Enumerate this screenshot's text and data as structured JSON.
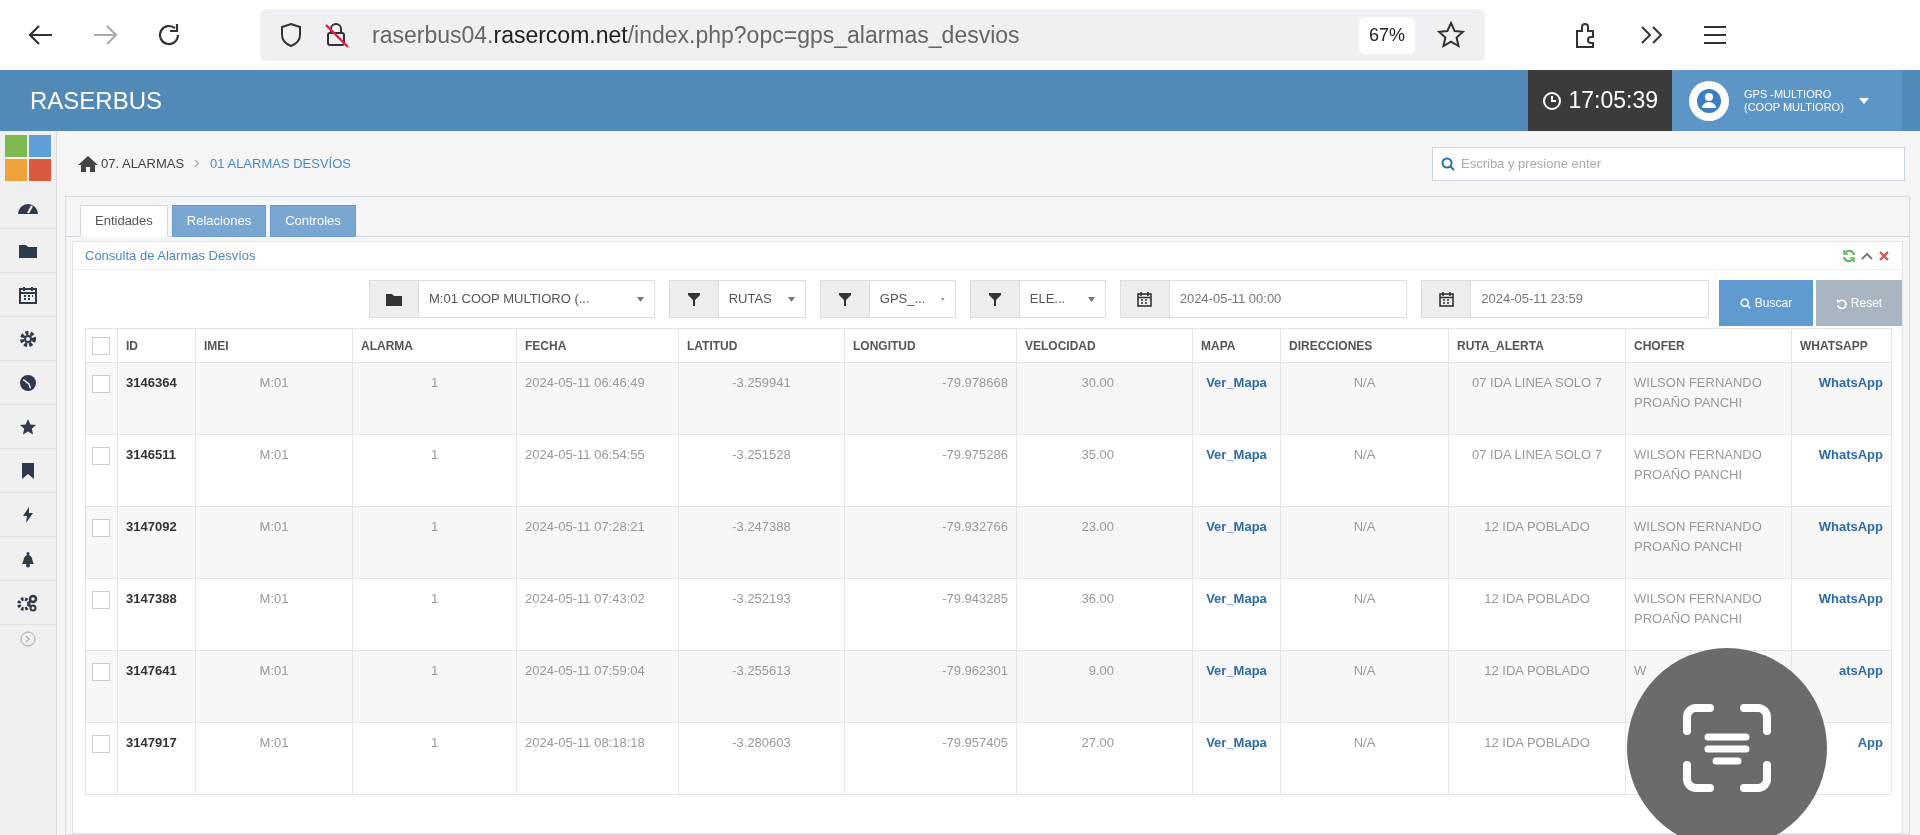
{
  "browser": {
    "url": "raserbus04.**rasercom.net**/index.php?opc=gps_alarmas_desvios",
    "zoom": "67%"
  },
  "header": {
    "brand": "RASERBUS",
    "clock": "17:05:39",
    "user": [
      "GPS -MULTIORO",
      "(COOP MULTIORO)"
    ]
  },
  "breadcrumb": [
    "07. ALARMAS",
    "01 ALARMAS DESVÍOS"
  ],
  "search": {
    "placeholder": "Escriba y presione enter"
  },
  "tabs": [
    {
      "label": "Entidades",
      "selected": true
    },
    {
      "label": "Relaciones",
      "selected": false
    },
    {
      "label": "Controles",
      "selected": false
    }
  ],
  "panel": {
    "title": "Consulta de Alarmas Desvíos"
  },
  "filters": [
    {
      "kind": "entity",
      "value": "M:01 COOP MULTIORO (..."
    },
    {
      "kind": "filter",
      "value": "RUTAS"
    },
    {
      "kind": "filter",
      "value": "GPS_..."
    },
    {
      "kind": "filter",
      "value": "ELE..."
    },
    {
      "kind": "date",
      "value": "2024-05-11 00:00"
    },
    {
      "kind": "date",
      "value": "2024-05-11 23:59"
    }
  ],
  "buttons": [
    "Buscar",
    "Reset"
  ],
  "table": {
    "all_checked": false,
    "columns": [
      "ID",
      "IMEI",
      "ALARMA",
      "FECHA",
      "LATITUD",
      "LONGITUD",
      "VELOCIDAD",
      "MAPA",
      "DIRECCIONES",
      "RUTA_ALERTA",
      "CHOFER",
      "WHATSAPP"
    ],
    "rows": [
      {
        "checked": false,
        "id": "3146364",
        "imei": "M:01",
        "alarma": "1",
        "fecha": "2024-05-11 06:46:49",
        "latitud": "-3.259941",
        "longitud": "-79.978668",
        "velocidad": "30.00",
        "mapa": "Ver_Mapa",
        "direcciones": "N/A",
        "ruta_alerta": "07 IDA LINEA SOLO 7",
        "chofer": "WILSON FERNANDO PROAÑO PANCHI",
        "whatsapp": "WhatsApp"
      },
      {
        "checked": false,
        "id": "3146511",
        "imei": "M:01",
        "alarma": "1",
        "fecha": "2024-05-11 06:54:55",
        "latitud": "-3.251528",
        "longitud": "-79.975286",
        "velocidad": "35.00",
        "mapa": "Ver_Mapa",
        "direcciones": "N/A",
        "ruta_alerta": "07 IDA LINEA SOLO 7",
        "chofer": "WILSON FERNANDO PROAÑO PANCHI",
        "whatsapp": "WhatsApp"
      },
      {
        "checked": false,
        "id": "3147092",
        "imei": "M:01",
        "alarma": "1",
        "fecha": "2024-05-11 07:28:21",
        "latitud": "-3.247388",
        "longitud": "-79.932766",
        "velocidad": "23.00",
        "mapa": "Ver_Mapa",
        "direcciones": "N/A",
        "ruta_alerta": "12 IDA POBLADO",
        "chofer": "WILSON FERNANDO PROAÑO PANCHI",
        "whatsapp": "WhatsApp"
      },
      {
        "checked": false,
        "id": "3147388",
        "imei": "M:01",
        "alarma": "1",
        "fecha": "2024-05-11 07:43:02",
        "latitud": "-3.252193",
        "longitud": "-79.943285",
        "velocidad": "36.00",
        "mapa": "Ver_Mapa",
        "direcciones": "N/A",
        "ruta_alerta": "12 IDA POBLADO",
        "chofer": "WILSON FERNANDO PROAÑO PANCHI",
        "whatsapp": "WhatsApp"
      },
      {
        "checked": false,
        "id": "3147641",
        "imei": "M:01",
        "alarma": "1",
        "fecha": "2024-05-11 07:59:04",
        "latitud": "-3.255613",
        "longitud": "-79.962301",
        "velocidad": "9.00",
        "mapa": "Ver_Mapa",
        "direcciones": "N/A",
        "ruta_alerta": "12 IDA POBLADO",
        "chofer": "W",
        "whatsapp": "atsApp"
      },
      {
        "checked": false,
        "id": "3147917",
        "imei": "M:01",
        "alarma": "1",
        "fecha": "2024-05-11 08:18:18",
        "latitud": "-3.280603",
        "longitud": "-79.957405",
        "velocidad": "27.00",
        "mapa": "Ver_Mapa",
        "direcciones": "N/A",
        "ruta_alerta": "12 IDA POBLADO",
        "whatsapp": "App"
      }
    ]
  }
}
